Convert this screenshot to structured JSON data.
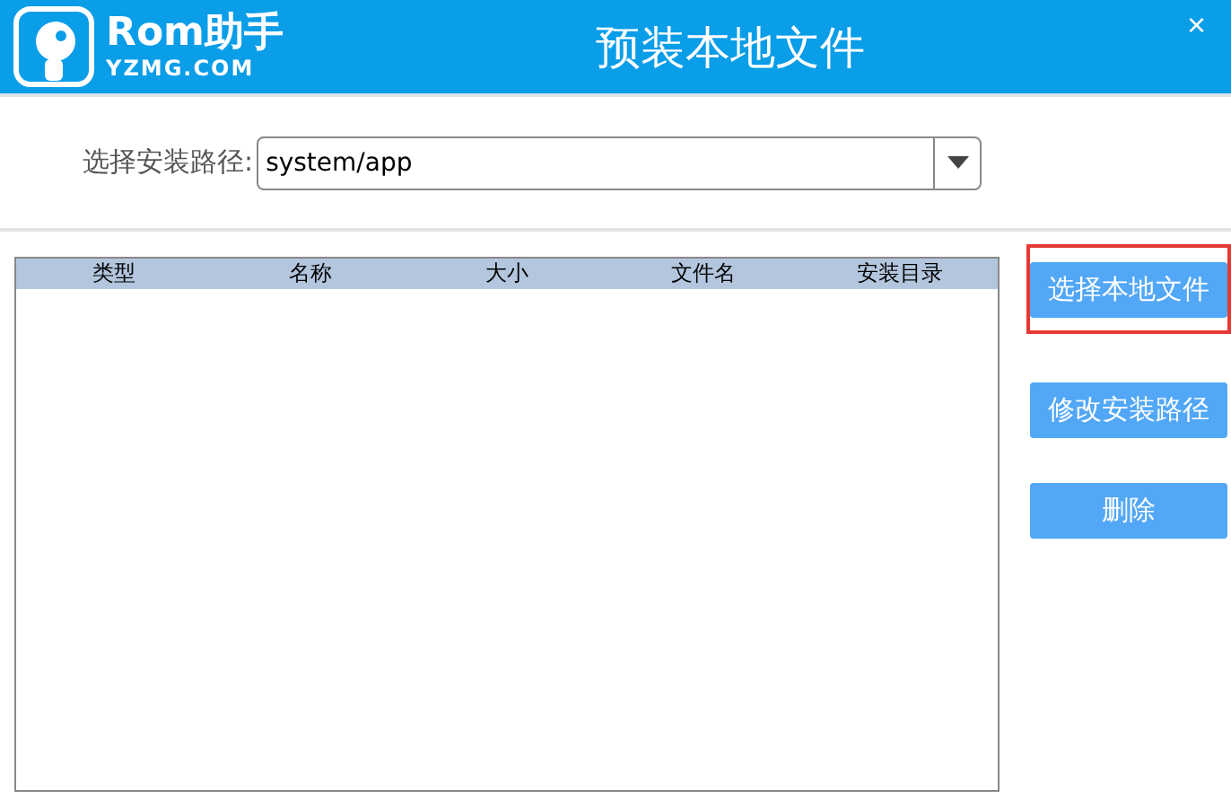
{
  "window": {
    "title": "预装本地文件",
    "close": "×",
    "logo": {
      "name": "Rom助手",
      "site": "YZMG.COM"
    }
  },
  "path": {
    "label": "选择安装路径:",
    "value": "system/app"
  },
  "table": {
    "columns": [
      "类型",
      "名称",
      "大小",
      "文件名",
      "安装目录"
    ]
  },
  "buttons": [
    {
      "label": "选择本地文件",
      "highlighted": true
    },
    {
      "label": "修改安装路径",
      "highlighted": false
    },
    {
      "label": "删除",
      "highlighted": false
    }
  ]
}
